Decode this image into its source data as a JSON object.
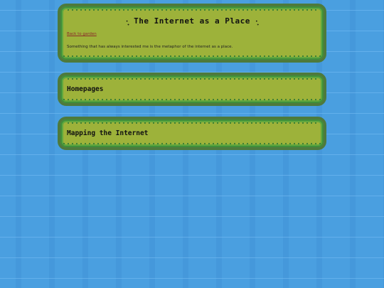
{
  "intro": {
    "title": "·̩͙ The Internet as a Place ·̩͙",
    "back_link": "Back to garden",
    "text": "Something that has always interested me is the metaphor of the internet as a place."
  },
  "sections": [
    {
      "heading": "Homepages"
    },
    {
      "heading": "Mapping the Internet"
    }
  ],
  "colors": {
    "background": "#4a9fe0",
    "panel": "#9db23a",
    "panel_border": "#4e7a3c",
    "link": "#8a2a2a"
  }
}
